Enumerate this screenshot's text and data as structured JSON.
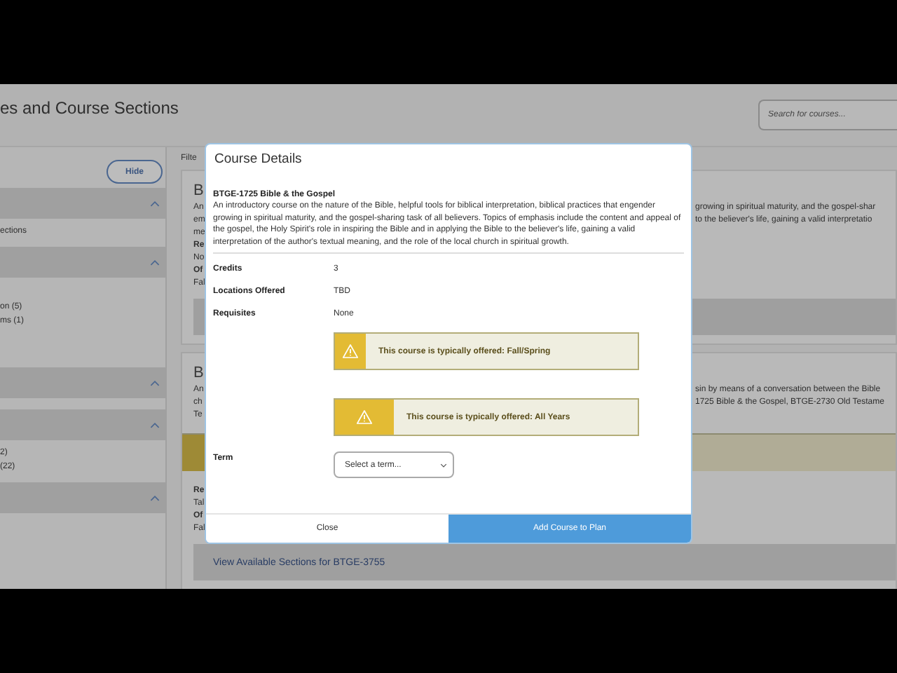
{
  "page": {
    "title": "es and Course Sections",
    "search": {
      "placeholder": "Search for courses..."
    },
    "sidebar": {
      "hide_button": "Hide",
      "sections": [
        {
          "expanded": true,
          "items": [
            "ections"
          ]
        },
        {
          "expanded": true,
          "items": [
            "on (5)",
            "ms (1)"
          ]
        },
        {
          "expanded": true
        },
        {
          "expanded": true,
          "items": [
            "2)",
            "(22)"
          ]
        },
        {
          "expanded": true
        }
      ]
    },
    "filter_label": "Filte",
    "cards": [
      {
        "heading": "B",
        "left_lines": [
          "An",
          "em",
          "me"
        ],
        "right_lines": [
          "growing in spiritual maturity, and the gospel-shar",
          "to the believer's life, gaining a valid interpretatio"
        ],
        "notice": false,
        "meta_lines": [
          "Re",
          "No",
          "Of",
          "Fal"
        ]
      },
      {
        "heading": "B",
        "left_lines": [
          "An",
          "ch",
          "Te"
        ],
        "right_lines": [
          "sin by means of a conversation between the Bible",
          "1725 Bible & the Gospel, BTGE-2730 Old Testame"
        ],
        "notice": true,
        "meta_lines": [
          "Re",
          "Tal",
          "Of",
          "Fal"
        ],
        "footer_link": "View Available Sections for BTGE-3755"
      }
    ]
  },
  "modal": {
    "title": "Course Details",
    "course_title": "BTGE-1725 Bible & the Gospel",
    "description": "An introductory course on the nature of the Bible, helpful tools for biblical interpretation, biblical practices that engender growing in spiritual maturity, and the gospel-sharing task of all believers. Topics of emphasis include the content and appeal of the gospel, the Holy Spirit's role in inspiring the Bible and in applying the Bible to the believer's life, gaining a valid interpretation of the author's textual meaning, and the role of the local church in spiritual growth.",
    "details": [
      {
        "label": "Credits",
        "value": "3"
      },
      {
        "label": "Locations Offered",
        "value": "TBD"
      },
      {
        "label": "Requisites",
        "value": "None"
      }
    ],
    "alerts": [
      {
        "text": "This course is typically offered: Fall/Spring",
        "kind": "narrow"
      },
      {
        "text": "This course is typically offered: All Years",
        "kind": "wide"
      }
    ],
    "term": {
      "label": "Term",
      "value": "Select a term..."
    },
    "buttons": [
      {
        "label": "Close",
        "kind": "secondary"
      },
      {
        "label": "Add Course to Plan",
        "kind": "primary"
      }
    ]
  }
}
